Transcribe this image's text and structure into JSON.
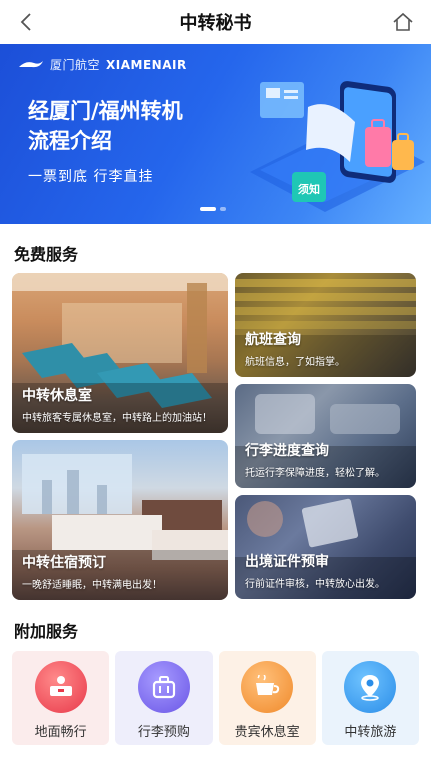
{
  "header": {
    "title": "中转秘书"
  },
  "banner": {
    "brand_cn": "厦门航空",
    "brand_en": "XIAMENAIR",
    "headline_line1": "经厦门/福州转机",
    "headline_line2": "流程介绍",
    "subline": "一票到底  行李直挂",
    "illus_badge": "须知"
  },
  "free_services": {
    "title": "免费服务",
    "items": [
      {
        "title": "中转休息室",
        "desc": "中转旅客专属休息室，中转路上的加油站！"
      },
      {
        "title": "中转住宿预订",
        "desc": "一晚舒适睡眠，中转满电出发！"
      },
      {
        "title": "航班查询",
        "desc": "航班信息，了如指掌。"
      },
      {
        "title": "行李进度查询",
        "desc": "托运行李保障进度，轻松了解。"
      },
      {
        "title": "出境证件预审",
        "desc": "行前证件审核，中转放心出发。"
      }
    ]
  },
  "additional_services": {
    "title": "附加服务",
    "items": [
      {
        "label": "地面畅行",
        "icon": "reception-desk-icon"
      },
      {
        "label": "行李预购",
        "icon": "suitcase-icon"
      },
      {
        "label": "贵宾休息室",
        "icon": "coffee-cup-icon"
      },
      {
        "label": "中转旅游",
        "icon": "map-pin-icon"
      }
    ]
  },
  "colors": {
    "banner_start": "#1c4fd8",
    "banner_end": "#66b1ff"
  }
}
